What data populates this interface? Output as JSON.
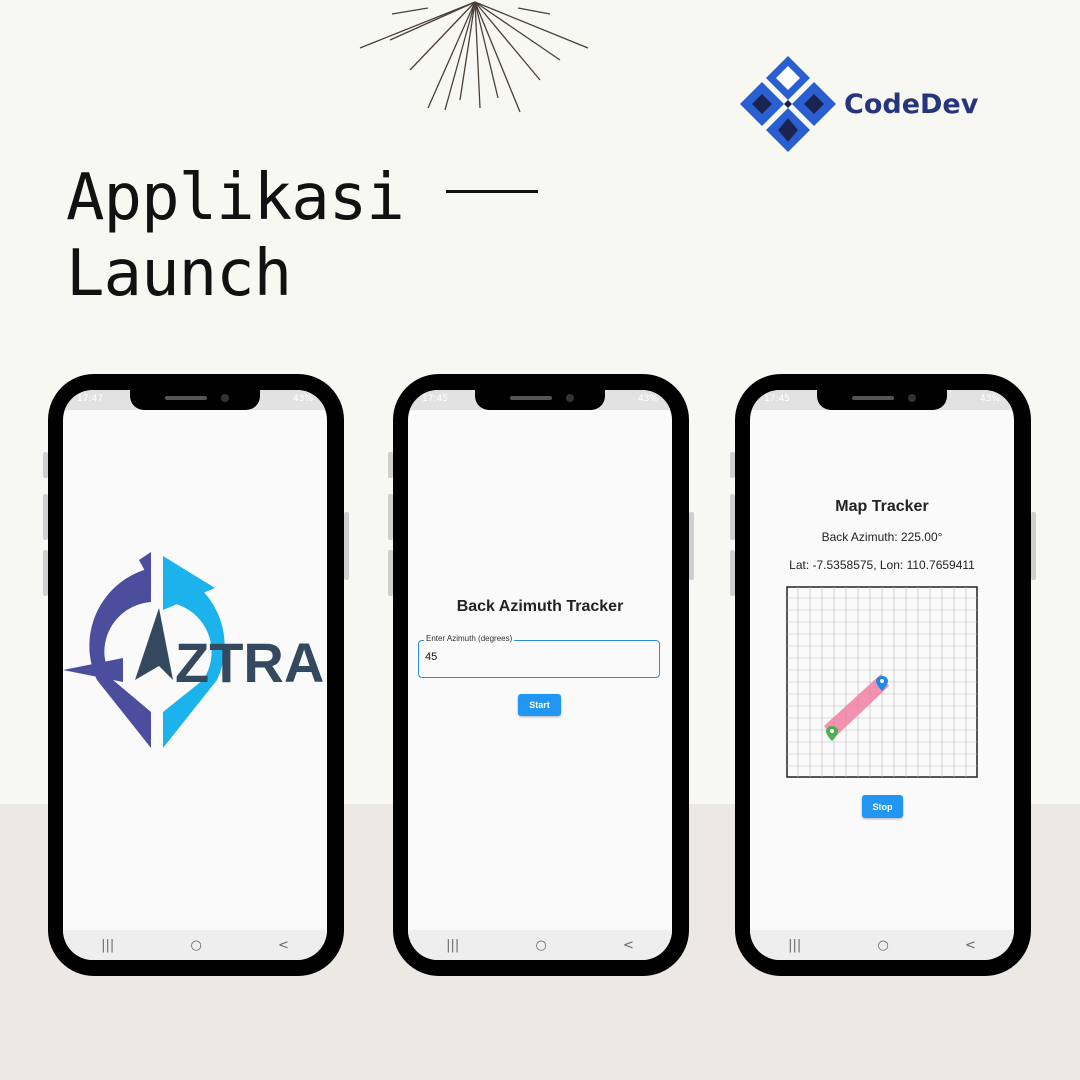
{
  "headline": {
    "line1": "Applikasi",
    "line2": "Launch"
  },
  "brand": {
    "name": "CodeDev"
  },
  "colors": {
    "accent": "#2196f3",
    "field_border": "#2a8de6",
    "brand_blue": "#2a5fd1",
    "brand_navy": "#1b2350",
    "track_path": "#f07fa0",
    "start_pin": "#4caf50",
    "end_pin": "#1e88e5"
  },
  "phone1": {
    "status": {
      "time": "17:47",
      "battery": "43%"
    },
    "logo_text": "ZTRA"
  },
  "phone2": {
    "status": {
      "time": "17:45",
      "battery": "43%"
    },
    "title": "Back Azimuth Tracker",
    "input_label": "Enter Azimuth (degrees)",
    "input_value": "45",
    "start_button": "Start"
  },
  "phone3": {
    "status": {
      "time": "17:45",
      "battery": "43%"
    },
    "title": "Map Tracker",
    "back_azimuth": "Back Azimuth: 225.00°",
    "coords": "Lat: -7.5358575, Lon: 110.7659411",
    "stop_button": "Stop"
  },
  "navbar": {
    "recents": "|||",
    "home": "○",
    "back": "<"
  }
}
